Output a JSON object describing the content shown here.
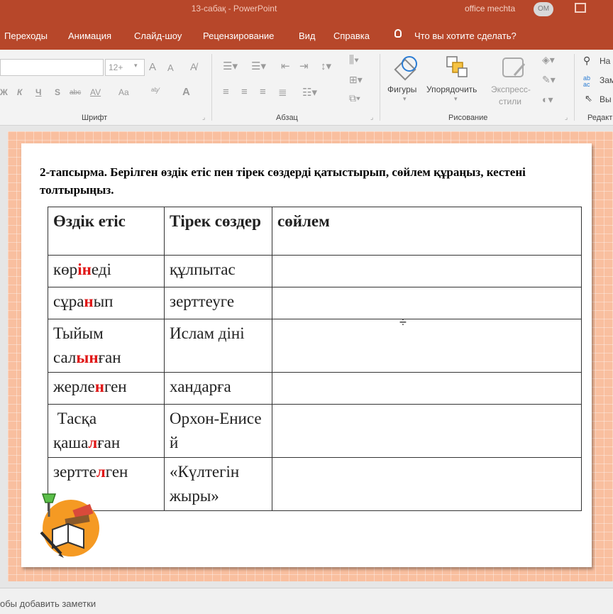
{
  "window": {
    "title": "13-сабақ  -  PowerPoint",
    "user_name": "office mechta",
    "user_initials": "OM",
    "accent": "#b7472a"
  },
  "tabs": [
    "Переходы",
    "Анимация",
    "Слайд-шоу",
    "Рецензирование",
    "Вид",
    "Справка"
  ],
  "tell_me": "Что вы хотите сделать?",
  "ribbon": {
    "font": {
      "size_value": "12+",
      "grow_label": "A",
      "shrink_label": "A",
      "bold": "Ж",
      "italic": "К",
      "underline": "Ч",
      "shadow": "S",
      "strike": "abc",
      "spacing": "AV",
      "case": "Aa",
      "color": "A",
      "group_label": "Шрифт"
    },
    "paragraph": {
      "group_label": "Абзац"
    },
    "drawing": {
      "shapes": "Фигуры",
      "arrange": "Упорядочить",
      "quick_styles_1": "Экспресс-",
      "quick_styles_2": "стили",
      "group_label": "Рисование"
    },
    "editing": {
      "find": "На",
      "replace": "Зам",
      "select": "Вы",
      "group_label": "Редакт"
    }
  },
  "slide": {
    "task": "2-тапсырма.  Берілген өздік етіс пен тірек сөздерді қатыстырып, сөйлем құраңыз, кестені толтырыңыз.",
    "headers": [
      "Өздік етіс",
      "Тірек сөздер",
      "сөйлем"
    ],
    "rows": [
      {
        "v_pre": "көр",
        "v_red": "ін",
        "v_post": "еді",
        "word": "құлпытас",
        "sentence": ""
      },
      {
        "v_pre": "сұра",
        "v_red": "н",
        "v_post": "ып",
        "word": "зерттеуге",
        "sentence": ""
      },
      {
        "v_pre": "Тыйым сал",
        "v_red": "ын",
        "v_post": "ған",
        "word": "Ислам діні",
        "sentence": ""
      },
      {
        "v_pre": "жерле",
        "v_red": "н",
        "v_post": "ген",
        "word": "хандарға",
        "sentence": ""
      },
      {
        "v_pre": " Тасқа қаша",
        "v_red": "л",
        "v_post": "ған",
        "word": "Орхон-Енисей",
        "sentence": ""
      },
      {
        "v_pre": "зертте",
        "v_red": "л",
        "v_post": "ген",
        "word": "«Күлтегін жыры»",
        "sentence": ""
      }
    ],
    "highlight_color": "#e01515"
  },
  "notes_placeholder": "обы добавить заметки"
}
